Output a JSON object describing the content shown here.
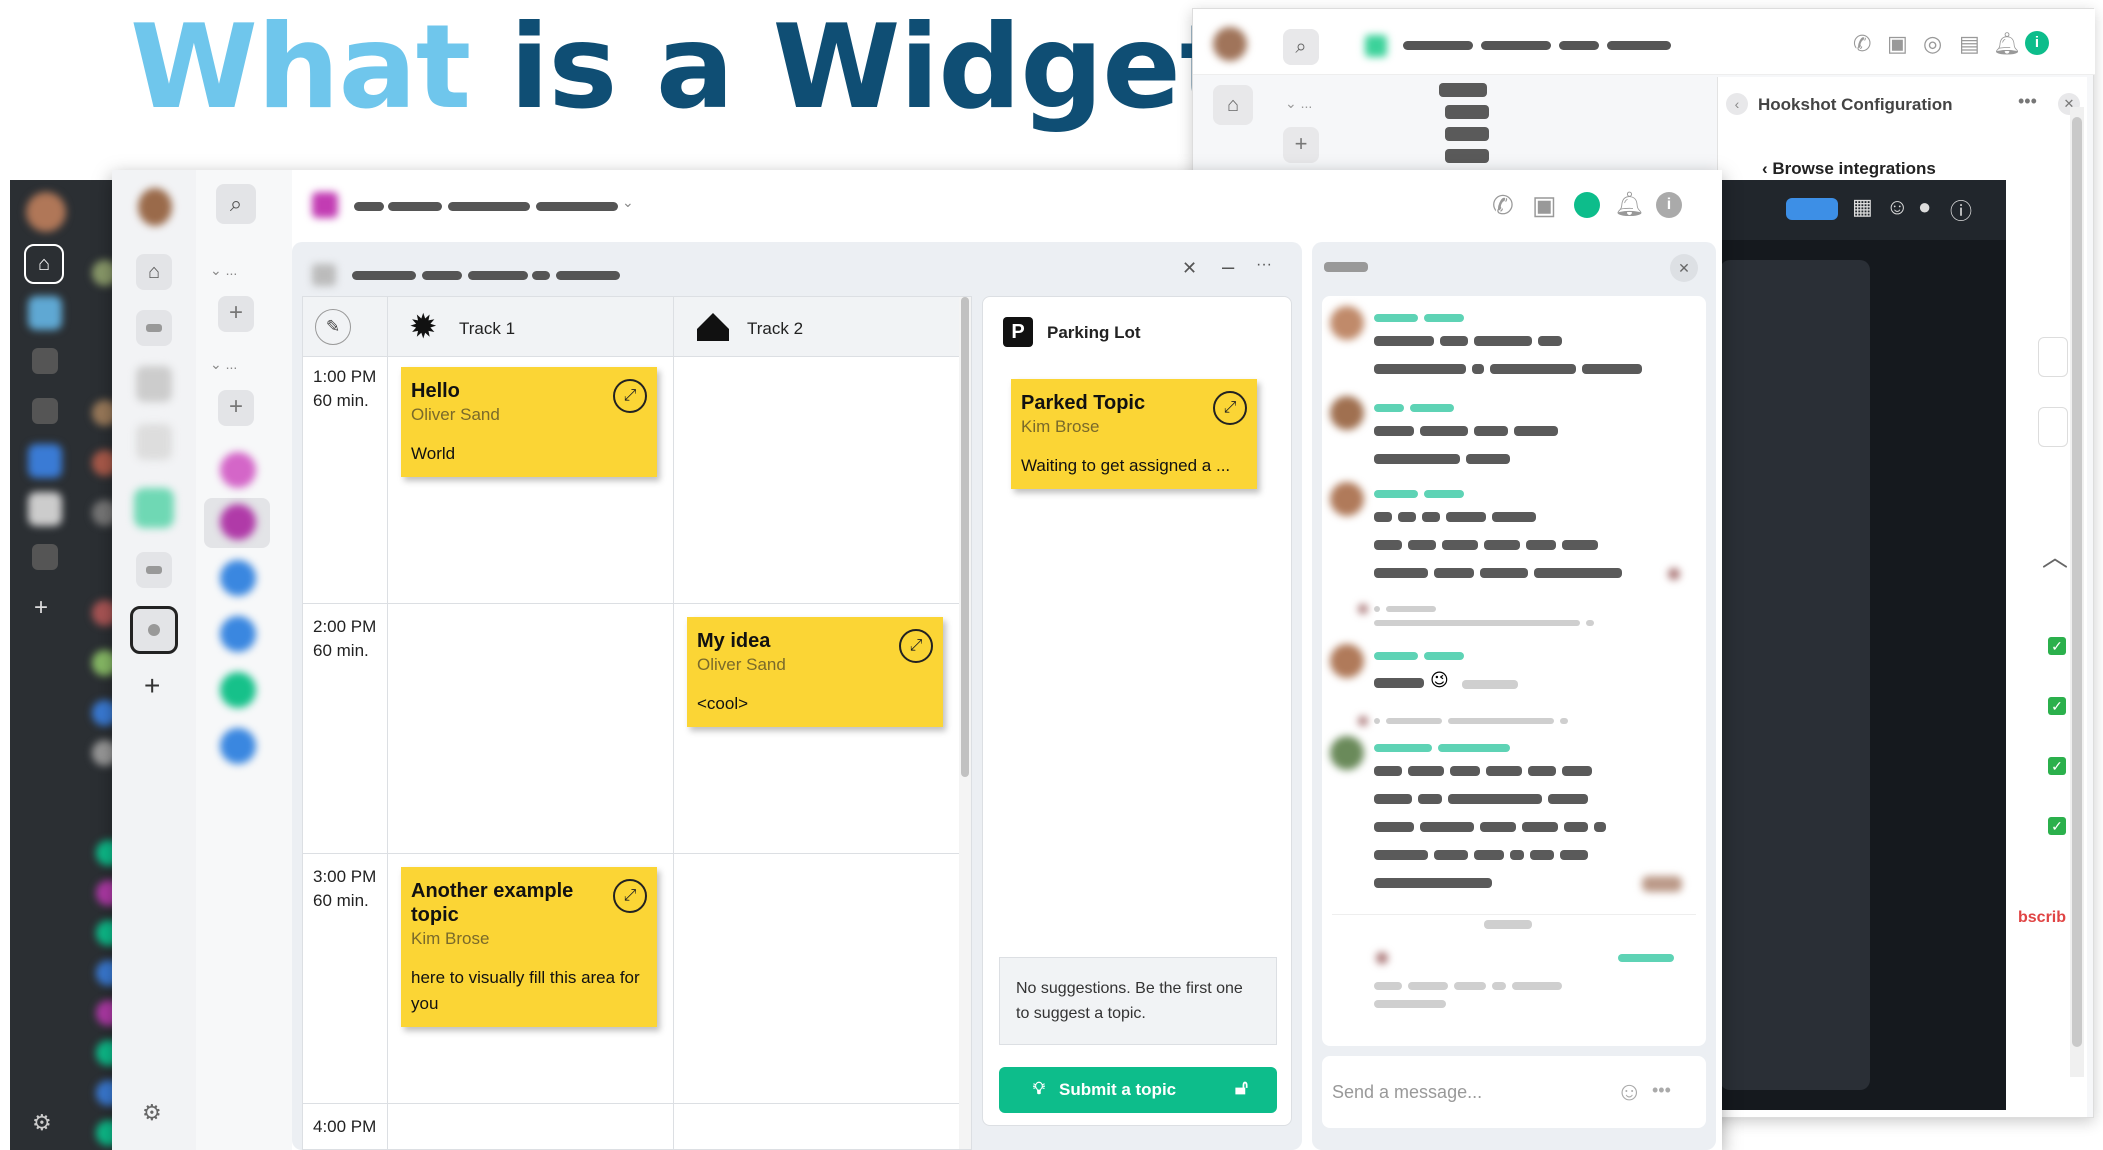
{
  "slide": {
    "title_first": "What",
    "title_rest": "is a Widget?"
  },
  "bg_window": {
    "panel_title": "Hookshot Configuration",
    "browse_label": "Browse integrations",
    "subscribe_fragment": "bscrib"
  },
  "widget": {
    "tracks": [
      {
        "label": "Track 1",
        "icon": "sun-icon"
      },
      {
        "label": "Track 2",
        "icon": "chair-icon"
      }
    ],
    "time_slots": [
      {
        "time": "1:00 PM",
        "duration": "60 min."
      },
      {
        "time": "2:00 PM",
        "duration": "60 min."
      },
      {
        "time": "3:00 PM",
        "duration": "60 min."
      },
      {
        "time": "4:00 PM",
        "duration": ""
      }
    ],
    "topics": [
      {
        "title": "Hello",
        "author": "Oliver Sand",
        "description": "World"
      },
      {
        "title": "My idea",
        "author": "Oliver Sand",
        "description": "<cool>"
      },
      {
        "title": "Another example topic",
        "author": "Kim Brose",
        "description": "here to visually fill this area for you"
      }
    ],
    "parking_lot": {
      "title": "Parking Lot",
      "topic": {
        "title": "Parked Topic",
        "author": "Kim Brose",
        "description": "Waiting to get assigned a ..."
      },
      "empty_message": "No suggestions. Be the first one to suggest a topic.",
      "submit_label": "Submit a topic"
    }
  },
  "chat": {
    "composer_placeholder": "Send a message..."
  },
  "colors": {
    "accent_green": "#0dbd8b",
    "sticky_yellow": "#fbd535",
    "title_light": "#6fc6ec",
    "title_dark": "#0f4e74"
  }
}
